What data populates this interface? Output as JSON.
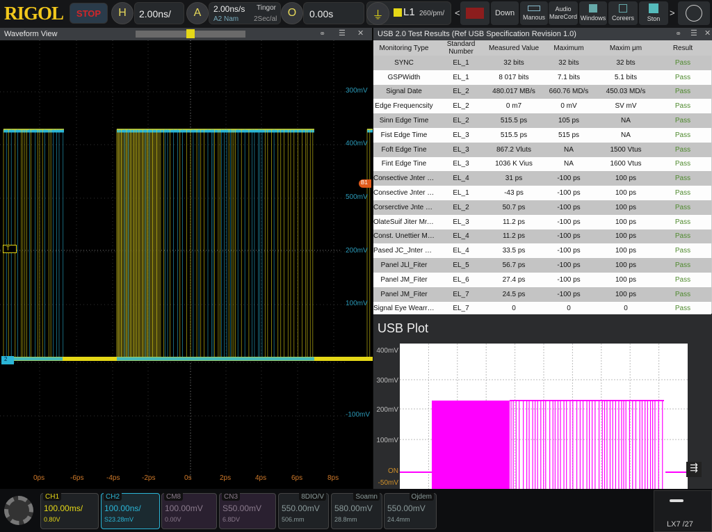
{
  "top": {
    "logo": "RIGOL",
    "stop": "STOP",
    "h_btn": "H",
    "timebase": "2.00ns/",
    "a_btn": "A",
    "sample_rate": "2.00ns/s",
    "trigger_label": "Tingor",
    "acq_sub": "A2 Nam",
    "acq_sub2": "2Sec/al",
    "o_btn": "O",
    "offset": "0.00s",
    "trig_level_badge": "L1",
    "trig_level": "260/pm/",
    "tools": [
      {
        "label": "Down",
        "icon": "none"
      },
      {
        "label": "Manous",
        "icon": "keyboard-icon"
      },
      {
        "label": "Audio MareCord",
        "icon": "none"
      },
      {
        "label": "Windows",
        "icon": "windows-icon"
      },
      {
        "label": "Coreers",
        "icon": "cursor-icon"
      },
      {
        "label": "Ston",
        "icon": "grid-icon"
      }
    ],
    "prev": "<",
    "next": ">"
  },
  "waveform": {
    "title": "Waveform View",
    "y_labels": [
      "300mV",
      "400mV",
      "500mV",
      "200mV",
      "100mV",
      "-100mV"
    ],
    "x_labels": [
      "0ps",
      "-6ps",
      "-4ps",
      "-2ps",
      "0s",
      "2ps",
      "4ps",
      "6ps",
      "8ps"
    ],
    "trigger_marker": "T",
    "ch_marker": "2",
    "ref_marker": "B1",
    "colors": {
      "ch1": "#e5d817",
      "ch2": "#2bb5d6"
    }
  },
  "results": {
    "title": "USB 2.0 Test Results (Ref USB Specification Revision 1.0)",
    "columns": [
      "Monitoring Type",
      "Standard Number",
      "Measured Value",
      "Maximum",
      "Maxim μm",
      "Result"
    ],
    "rows": [
      [
        "SYNC",
        "EL_1",
        "32 bits",
        "32 bits",
        "32 bts",
        "Pass"
      ],
      [
        "GSPWidth",
        "EL_1",
        "8 017 bits",
        "7.1 bits",
        "5.1 bits",
        "Pass"
      ],
      [
        "Signal Date",
        "EL_2",
        "480.017 MB/s",
        "660.76 MD/s",
        "450.03 MD/s",
        "Pass"
      ],
      [
        "Edge Frequencsity",
        "EL_2",
        "0 m7",
        "0 mV",
        "SV mV",
        "Pass"
      ],
      [
        "Sinn Edge Time",
        "EL_2",
        "515.5 ps",
        "105 ps",
        "NA",
        "Pass"
      ],
      [
        "Fist Edge Time",
        "EL_3",
        "515.5 ps",
        "515 ps",
        "NA",
        "Pass"
      ],
      [
        "Foft Edge Tine",
        "EL_3",
        "867.2 Vluts",
        "NA",
        "1500 Vtus",
        "Pass"
      ],
      [
        "Fint Edge Tine",
        "EL_3",
        "1036 K Vius",
        "NA",
        "1600 Vtus",
        "Pass"
      ],
      [
        "Consective Jnter M...",
        "EL_4",
        "31 ps",
        "-100 ps",
        "100 ps",
        "Pass"
      ],
      [
        "Consective Jnter M...",
        "EL_1",
        "-43 ps",
        "-100 ps",
        "100 ps",
        "Pass"
      ],
      [
        "Corserctive Jnte rT...",
        "EL_2",
        "50.7 ps",
        "-100 ps",
        "100 ps",
        "Pass"
      ],
      [
        "OlateSuif Jiter Mr. II.",
        "EL_3",
        "11.2 ps",
        "-100 ps",
        "100 ps",
        "Pass"
      ],
      [
        "Const. Unettier Mr...",
        "EL_4",
        "11.2 ps",
        "-100 ps",
        "100 ps",
        "Pass"
      ],
      [
        "Pased JC_Jnter Plot...",
        "EL_4",
        "33.5 ps",
        "-100 ps",
        "100 ps",
        "Pass"
      ],
      [
        "Panel JLl_Fiter",
        "EL_5",
        "56.7 ps",
        "-100 ps",
        "100 ps",
        "Pass"
      ],
      [
        "Panel JM_Fiter",
        "EL_6",
        "27.4 ps",
        "-100 ps",
        "100 ps",
        "Pass"
      ],
      [
        "Panel JM_Fiter",
        "EL_7",
        "24.5 ps",
        "-100 ps",
        "100 ps",
        "Pass"
      ],
      [
        "Signal Eye Wearren...",
        "EL_7",
        "0",
        "0",
        "0",
        "Pass"
      ]
    ]
  },
  "usb_plot": {
    "title": "USB Plot",
    "y_labels": [
      "400mV",
      "300mV",
      "200mV",
      "100mV",
      "ON",
      "-50mV"
    ],
    "color": "#ff00ff"
  },
  "channels": [
    {
      "label": "CH1",
      "value": "100.00ms/",
      "sub": "0.80V",
      "color": "#e5d817"
    },
    {
      "label": "CH2",
      "value": "100.00ns/",
      "sub": "S23.28mV",
      "color": "#2bb5d6"
    },
    {
      "label": "CM8",
      "value": "100.00mV",
      "sub": "0.00V",
      "color": "#8a7a8c"
    },
    {
      "label": "CN3",
      "value": "S50.00mV",
      "sub": "6.8DV",
      "color": "#8a7a8c"
    },
    {
      "label": "8DIO/V",
      "value": "550.00mV",
      "sub": "506.mm",
      "color": "#8a9a9a"
    },
    {
      "label": "Soamn",
      "value": "580.00mV",
      "sub": "28.8mm",
      "color": "#8a9a9a"
    },
    {
      "label": "Ojdem",
      "value": "550.00mV",
      "sub": "24.4mm",
      "color": "#8a9a9a"
    }
  ],
  "clock": "LX7 /27"
}
